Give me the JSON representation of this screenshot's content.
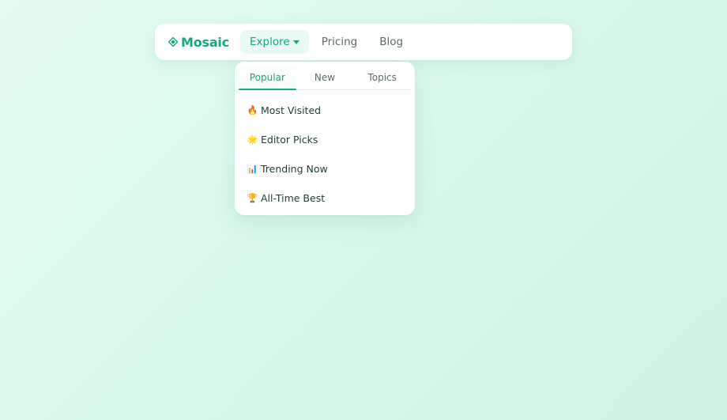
{
  "brand": {
    "name": "Mosaic",
    "icon": "diamond-icon",
    "color": "#16a877"
  },
  "nav": {
    "items": [
      {
        "label": "Explore",
        "active": true,
        "has_dropdown": true
      },
      {
        "label": "Pricing",
        "active": false
      },
      {
        "label": "Blog",
        "active": false
      }
    ]
  },
  "dropdown": {
    "tabs": [
      {
        "label": "Popular",
        "active": true
      },
      {
        "label": "New",
        "active": false
      },
      {
        "label": "Topics",
        "active": false
      }
    ],
    "items": [
      {
        "icon": "fire-icon",
        "glyph": "🔥",
        "label": "Most Visited"
      },
      {
        "icon": "star-icon",
        "glyph": "🌟",
        "label": "Editor Picks"
      },
      {
        "icon": "bar-chart-icon",
        "glyph": "📊",
        "label": "Trending Now"
      },
      {
        "icon": "trophy-icon",
        "glyph": "🏆",
        "label": "All-Time Best"
      }
    ]
  },
  "colors": {
    "accent": "#16a877",
    "accent_bg": "#e8faf2",
    "text_muted": "#5b6b67",
    "text_dark": "#1f3d33"
  }
}
